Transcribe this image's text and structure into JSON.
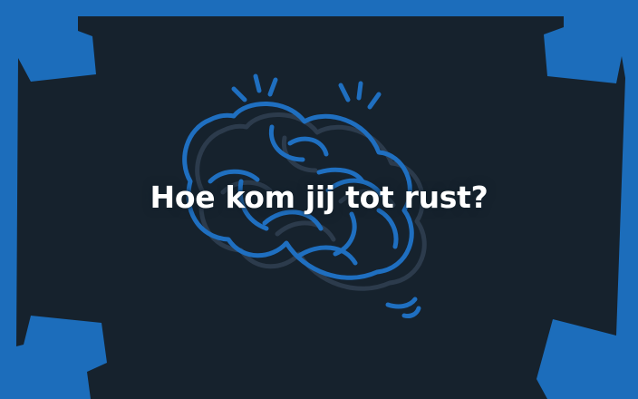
{
  "colors": {
    "frame_blue": "#1c6dbb",
    "panel_dark": "#16222d",
    "line_blue": "#1f6fc0",
    "line_shadow": "#2c3b4c",
    "text_white": "#ffffff"
  },
  "icon": "brain-icon",
  "headline": "Hoe kom jij tot rust?"
}
